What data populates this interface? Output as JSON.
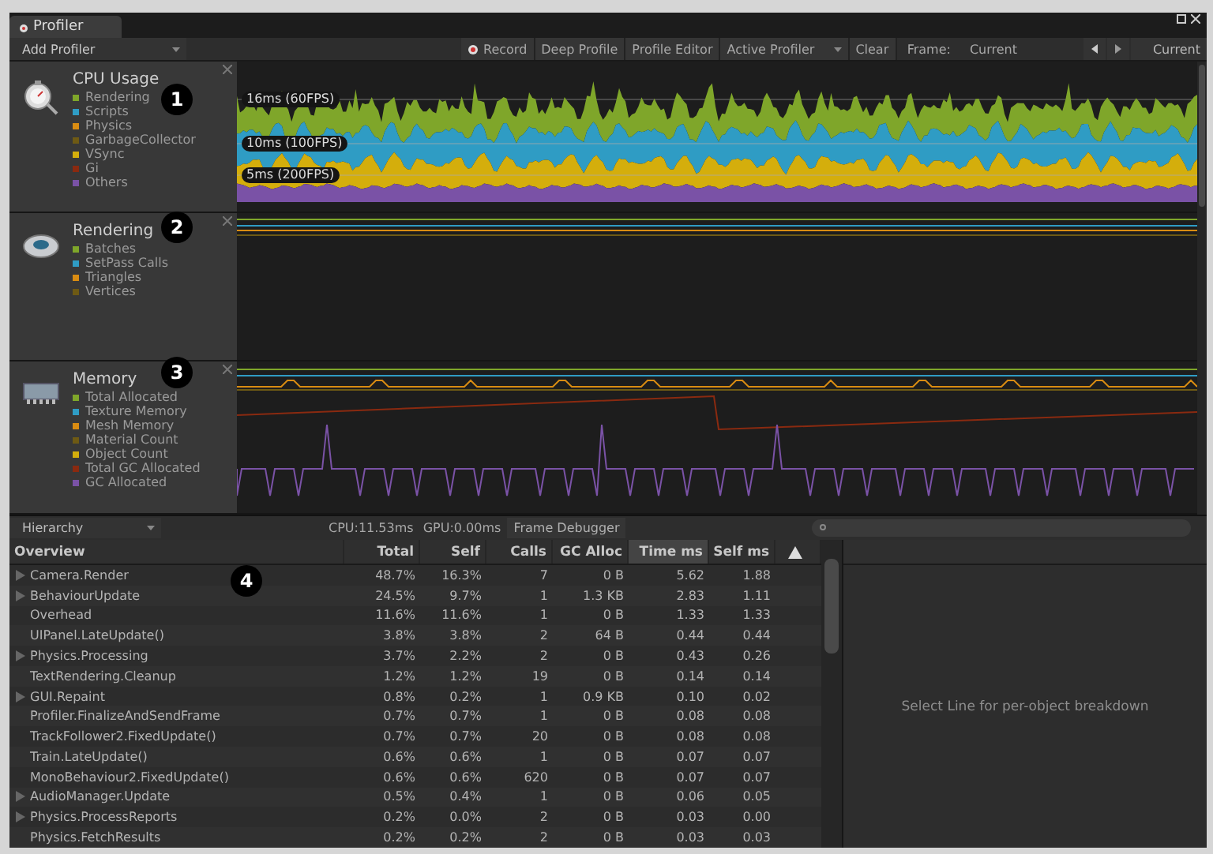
{
  "window": {
    "tab": "Profiler"
  },
  "toolbar": {
    "add_profiler": "Add Profiler",
    "buttons": [
      {
        "label": "Record",
        "kind": "record"
      },
      {
        "label": "Deep Profile",
        "kind": "plain"
      },
      {
        "label": "Profile Editor",
        "kind": "plain"
      },
      {
        "label": "Active Profiler",
        "kind": "dropdown"
      },
      {
        "label": "Clear",
        "kind": "plain"
      }
    ],
    "frame_label": "Frame:",
    "frame_value": "Current",
    "current_button": "Current"
  },
  "profilers": [
    {
      "kind": "cpu",
      "title": "CPU Usage",
      "callout": "1",
      "guides": [
        "16ms (60FPS)",
        "10ms (100FPS)",
        "5ms (200FPS)"
      ],
      "legend": [
        {
          "label": "Rendering",
          "color": "#7fa62a"
        },
        {
          "label": "Scripts",
          "color": "#2f9cc4"
        },
        {
          "label": "Physics",
          "color": "#d98c12"
        },
        {
          "label": "GarbageCollector",
          "color": "#6e5a14"
        },
        {
          "label": "VSync",
          "color": "#d4ae0c"
        },
        {
          "label": "Gi",
          "color": "#8a2a10"
        },
        {
          "label": "Others",
          "color": "#7a52a6"
        }
      ]
    },
    {
      "kind": "rendering",
      "title": "Rendering",
      "callout": "2",
      "legend": [
        {
          "label": "Batches",
          "color": "#7fa62a"
        },
        {
          "label": "SetPass Calls",
          "color": "#2f9cc4"
        },
        {
          "label": "Triangles",
          "color": "#d98c12"
        },
        {
          "label": "Vertices",
          "color": "#6e5a14"
        }
      ]
    },
    {
      "kind": "memory",
      "title": "Memory",
      "callout": "3",
      "legend": [
        {
          "label": "Total Allocated",
          "color": "#7fa62a"
        },
        {
          "label": "Texture Memory",
          "color": "#2f9cc4"
        },
        {
          "label": "Mesh Memory",
          "color": "#d98c12"
        },
        {
          "label": "Material Count",
          "color": "#6e5a14"
        },
        {
          "label": "Object Count",
          "color": "#d4ae0c"
        },
        {
          "label": "Total GC Allocated",
          "color": "#8a2a10"
        },
        {
          "label": "GC Allocated",
          "color": "#7a52a6"
        }
      ]
    }
  ],
  "hierarchy": {
    "view": "Hierarchy",
    "cpu": "CPU:11.53ms",
    "gpu": "GPU:0.00ms",
    "frame_debugger": "Frame Debugger",
    "callout": "4",
    "columns": [
      {
        "label": "Overview",
        "selected": false
      },
      {
        "label": "Total",
        "selected": false
      },
      {
        "label": "Self",
        "selected": false
      },
      {
        "label": "Calls",
        "selected": false
      },
      {
        "label": "GC Alloc",
        "selected": false
      },
      {
        "label": "Time ms",
        "selected": true
      },
      {
        "label": "Self ms",
        "selected": false
      }
    ],
    "rows": [
      {
        "expandable": true,
        "cells": [
          "Camera.Render",
          "48.7%",
          "16.3%",
          "7",
          "0 B",
          "5.62",
          "1.88"
        ]
      },
      {
        "expandable": true,
        "cells": [
          "BehaviourUpdate",
          "24.5%",
          "9.7%",
          "1",
          "1.3 KB",
          "2.83",
          "1.11"
        ]
      },
      {
        "expandable": false,
        "cells": [
          "Overhead",
          "11.6%",
          "11.6%",
          "1",
          "0 B",
          "1.33",
          "1.33"
        ]
      },
      {
        "expandable": false,
        "cells": [
          "UIPanel.LateUpdate()",
          "3.8%",
          "3.8%",
          "2",
          "64 B",
          "0.44",
          "0.44"
        ]
      },
      {
        "expandable": true,
        "cells": [
          "Physics.Processing",
          "3.7%",
          "2.2%",
          "2",
          "0 B",
          "0.43",
          "0.26"
        ]
      },
      {
        "expandable": false,
        "cells": [
          "TextRendering.Cleanup",
          "1.2%",
          "1.2%",
          "19",
          "0 B",
          "0.14",
          "0.14"
        ]
      },
      {
        "expandable": true,
        "cells": [
          "GUI.Repaint",
          "0.8%",
          "0.2%",
          "1",
          "0.9 KB",
          "0.10",
          "0.02"
        ]
      },
      {
        "expandable": false,
        "cells": [
          "Profiler.FinalizeAndSendFrame",
          "0.7%",
          "0.7%",
          "1",
          "0 B",
          "0.08",
          "0.08"
        ]
      },
      {
        "expandable": false,
        "cells": [
          "TrackFollower2.FixedUpdate()",
          "0.7%",
          "0.7%",
          "20",
          "0 B",
          "0.08",
          "0.08"
        ]
      },
      {
        "expandable": false,
        "cells": [
          "Train.LateUpdate()",
          "0.6%",
          "0.6%",
          "1",
          "0 B",
          "0.07",
          "0.07"
        ]
      },
      {
        "expandable": false,
        "cells": [
          "MonoBehaviour2.FixedUpdate()",
          "0.6%",
          "0.6%",
          "620",
          "0 B",
          "0.07",
          "0.07"
        ]
      },
      {
        "expandable": true,
        "cells": [
          "AudioManager.Update",
          "0.5%",
          "0.4%",
          "1",
          "0 B",
          "0.06",
          "0.05"
        ]
      },
      {
        "expandable": true,
        "cells": [
          "Physics.ProcessReports",
          "0.2%",
          "0.0%",
          "2",
          "0 B",
          "0.03",
          "0.00"
        ]
      },
      {
        "expandable": false,
        "cells": [
          "Physics.FetchResults",
          "0.2%",
          "0.2%",
          "2",
          "0 B",
          "0.03",
          "0.03"
        ]
      }
    ]
  },
  "details": {
    "message": "Select Line for per-object breakdown"
  }
}
